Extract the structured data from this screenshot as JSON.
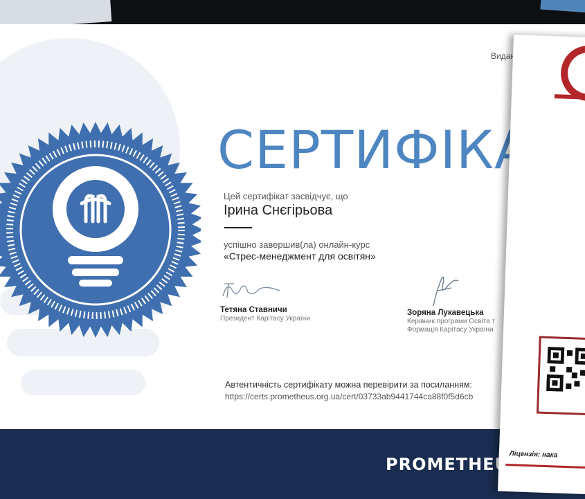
{
  "certificate": {
    "issued_by": "Виданий",
    "title": "СЕРТИФІКА",
    "certifies": "Цей сертифікат засвідчує, що",
    "recipient": "Ірина Снєгірьова",
    "completed": "успішно завершив(ла) онлайн-курс",
    "course": "«Стрес-менеджмент для освітян»",
    "signer1_name": "Тетяна Ставничи",
    "signer1_role": "Президент Карітасу України",
    "signer2_name": "Зоряна Лукавецька",
    "signer2_role_line1": "Керівник програми Освіта т",
    "signer2_role_line2": "Формація Карітасу України",
    "verify_text": "Автентичність сертифікату можна перевірити за посиланням:",
    "verify_url": "https://certs.prometheus.org.ua/cert/03733ab9441744ca88f0f5d6cb",
    "brand": "PROMETHEU"
  },
  "overlay_document": {
    "license_text": "Ліцензія: нака"
  },
  "colors": {
    "title_blue": "#4e86c2",
    "seal_blue": "#3f6fae",
    "footer_navy": "#1a2d50",
    "overlay_red": "#b3262a"
  },
  "icons": {
    "seal": "lightbulb-seal-icon",
    "brand": "prometheus-logo",
    "qr": "qr-code-icon"
  }
}
